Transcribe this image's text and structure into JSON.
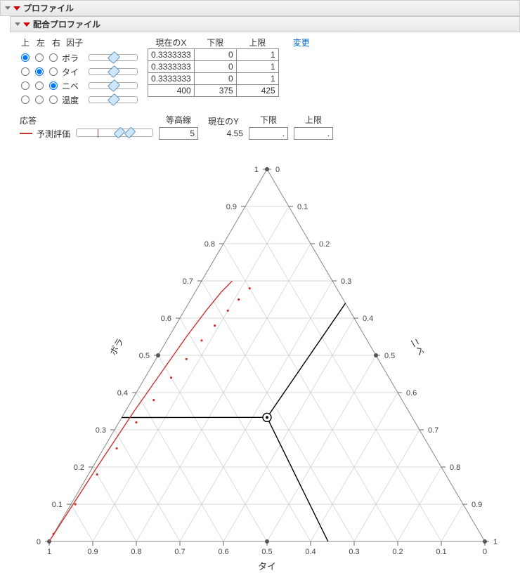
{
  "panel1_title": "プロファイル",
  "panel2_title": "配合プロファイル",
  "header": {
    "top": "上",
    "left": "左",
    "right": "右",
    "factor": "因子",
    "currentX": "現在のX",
    "lower": "下限",
    "upper": "上限",
    "change": "変更"
  },
  "factors": [
    {
      "name": "ボラ",
      "selTop": true,
      "selLeft": false,
      "selRight": false,
      "knob": 0.5,
      "cur": "0.3333333",
      "lo": "0",
      "hi": "1"
    },
    {
      "name": "タイ",
      "selTop": false,
      "selLeft": true,
      "selRight": false,
      "knob": 0.5,
      "cur": "0.3333333",
      "lo": "0",
      "hi": "1"
    },
    {
      "name": "ニベ",
      "selTop": false,
      "selLeft": false,
      "selRight": true,
      "knob": 0.5,
      "cur": "0.3333333",
      "lo": "0",
      "hi": "1"
    },
    {
      "name": "温度",
      "selTop": false,
      "selLeft": false,
      "selRight": false,
      "knob": 0.5,
      "cur": "400",
      "lo": "375",
      "hi": "425"
    }
  ],
  "response": {
    "label": "応答",
    "name": "予測評価",
    "contour_label": "等高線",
    "contour": "5",
    "currentY_label": "現在のY",
    "currentY": "4.55",
    "lower_label": "下限",
    "upper_label": "上限",
    "lower": ".",
    "upper": "."
  },
  "chart_data": {
    "type": "ternary",
    "axes": {
      "top": "ボラ",
      "bottom": "タイ",
      "right": "ニベ"
    },
    "ticks": [
      0,
      0.1,
      0.2,
      0.3,
      0.4,
      0.5,
      0.6,
      0.7,
      0.8,
      0.9,
      1
    ],
    "crosshair": {
      "bora": 0.3333,
      "tai": 0.3333,
      "nibe": 0.3333
    },
    "crosshair_arms": [
      {
        "to": {
          "bora": 0.333,
          "tai": 0.667,
          "nibe": 0.0
        }
      },
      {
        "to": {
          "bora": 0.0,
          "tai": 0.36,
          "nibe": 0.64
        }
      },
      {
        "to": {
          "bora": 0.64,
          "tai": 0.0,
          "nibe": 0.36
        }
      }
    ],
    "contour_solid": [
      {
        "bora": 0.0,
        "tai": 1.0,
        "nibe": 0.0
      },
      {
        "bora": 0.2,
        "tai": 0.79,
        "nibe": 0.01
      },
      {
        "bora": 0.35,
        "tai": 0.63,
        "nibe": 0.02
      },
      {
        "bora": 0.45,
        "tai": 0.52,
        "nibe": 0.03
      },
      {
        "bora": 0.55,
        "tai": 0.41,
        "nibe": 0.04
      },
      {
        "bora": 0.62,
        "tai": 0.33,
        "nibe": 0.05
      },
      {
        "bora": 0.67,
        "tai": 0.27,
        "nibe": 0.06
      },
      {
        "bora": 0.7,
        "tai": 0.23,
        "nibe": 0.07
      }
    ],
    "contour_dotted": [
      {
        "bora": 0.02,
        "tai": 0.98,
        "nibe": 0.0
      },
      {
        "bora": 0.1,
        "tai": 0.89,
        "nibe": 0.01
      },
      {
        "bora": 0.18,
        "tai": 0.8,
        "nibe": 0.02
      },
      {
        "bora": 0.25,
        "tai": 0.72,
        "nibe": 0.03
      },
      {
        "bora": 0.32,
        "tai": 0.64,
        "nibe": 0.04
      },
      {
        "bora": 0.38,
        "tai": 0.57,
        "nibe": 0.05
      },
      {
        "bora": 0.44,
        "tai": 0.5,
        "nibe": 0.06
      },
      {
        "bora": 0.49,
        "tai": 0.44,
        "nibe": 0.07
      },
      {
        "bora": 0.54,
        "tai": 0.38,
        "nibe": 0.08
      },
      {
        "bora": 0.58,
        "tai": 0.33,
        "nibe": 0.09
      },
      {
        "bora": 0.62,
        "tai": 0.28,
        "nibe": 0.1
      },
      {
        "bora": 0.65,
        "tai": 0.24,
        "nibe": 0.11
      },
      {
        "bora": 0.68,
        "tai": 0.2,
        "nibe": 0.12
      }
    ]
  }
}
